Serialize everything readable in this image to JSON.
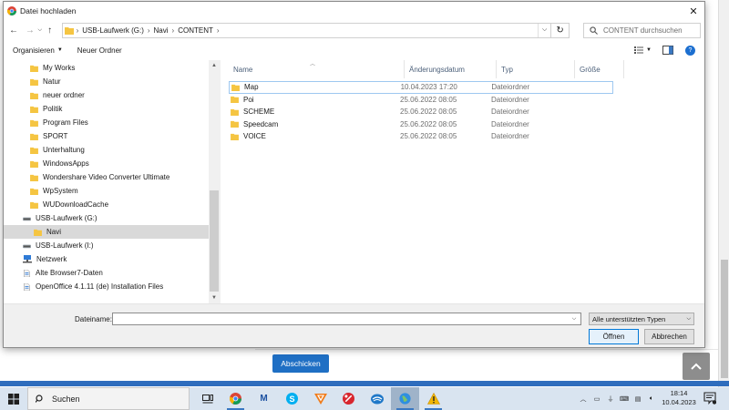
{
  "colors": {
    "accent": "#0078d7",
    "folder": "#f5c542",
    "submit": "#1f6fc4",
    "selected": "#d9d9d9"
  },
  "dialog": {
    "title": "Datei hochladen",
    "close_icon": "close-icon",
    "address": {
      "crumbs": [
        "USB-Laufwerk (G:)",
        "Navi",
        "CONTENT"
      ]
    },
    "search": {
      "placeholder": "CONTENT durchsuchen"
    },
    "toolbar": {
      "organize_label": "Organisieren",
      "new_folder_label": "Neuer Ordner"
    },
    "nav_tree": [
      {
        "label": "My Works",
        "icon": "folder-icon"
      },
      {
        "label": "Natur",
        "icon": "folder-icon"
      },
      {
        "label": "neuer ordner",
        "icon": "folder-icon"
      },
      {
        "label": "Politik",
        "icon": "folder-icon"
      },
      {
        "label": "Program Files",
        "icon": "folder-icon"
      },
      {
        "label": "SPORT",
        "icon": "folder-icon"
      },
      {
        "label": "Unterhaltung",
        "icon": "folder-icon"
      },
      {
        "label": "WindowsApps",
        "icon": "folder-icon"
      },
      {
        "label": "Wondershare Video Converter Ultimate",
        "icon": "folder-icon"
      },
      {
        "label": "WpSystem",
        "icon": "folder-icon"
      },
      {
        "label": "WUDownloadCache",
        "icon": "folder-icon"
      },
      {
        "label": "USB-Laufwerk (G:)",
        "icon": "drive-icon"
      },
      {
        "label": "Navi",
        "icon": "folder-icon",
        "selected": true
      },
      {
        "label": "USB-Laufwerk (I:)",
        "icon": "drive-icon"
      },
      {
        "label": "Netzwerk",
        "icon": "network-icon"
      },
      {
        "label": "Alte Browser7-Daten",
        "icon": "file-icon"
      },
      {
        "label": "OpenOffice 4.1.11 (de) Installation Files",
        "icon": "file-icon"
      }
    ],
    "columns": {
      "name": "Name",
      "date": "Änderungsdatum",
      "type": "Typ",
      "size": "Größe"
    },
    "files": [
      {
        "name": "Map",
        "date": "10.04.2023 17:20",
        "type": "Dateiordner"
      },
      {
        "name": "Poi",
        "date": "25.06.2022 08:05",
        "type": "Dateiordner"
      },
      {
        "name": "SCHEME",
        "date": "25.06.2022 08:05",
        "type": "Dateiordner"
      },
      {
        "name": "Speedcam",
        "date": "25.06.2022 08:05",
        "type": "Dateiordner"
      },
      {
        "name": "VOICE",
        "date": "25.06.2022 08:05",
        "type": "Dateiordner"
      }
    ],
    "filename_label": "Dateiname:",
    "filename_value": "",
    "file_type": "Alle unterstützten Typen",
    "open_label": "Öffnen",
    "cancel_label": "Abbrechen"
  },
  "webpage": {
    "submit_label": "Abschicken"
  },
  "taskbar": {
    "search_label": "Suchen",
    "time": "18:14",
    "date": "10.04.2023",
    "apps": [
      "task-view-icon",
      "chrome-icon",
      "malwarebytes-icon",
      "skype-icon",
      "vivaldi-icon",
      "tools-icon",
      "thunderbird-icon",
      "globe-icon",
      "warning-icon"
    ]
  }
}
